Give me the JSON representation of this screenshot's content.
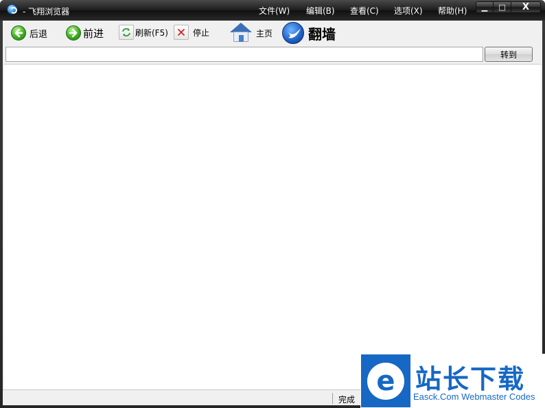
{
  "window": {
    "title": "- 飞翔浏览器",
    "controls": {
      "minimize": "▁",
      "maximize": "□",
      "close": "X"
    }
  },
  "menu": [
    {
      "label": "文件(W)"
    },
    {
      "label": "编辑(B)"
    },
    {
      "label": "查看(C)"
    },
    {
      "label": "选项(X)"
    },
    {
      "label": "帮助(H)"
    }
  ],
  "toolbar": {
    "back_label": "后退",
    "forward_label": "前进",
    "refresh_label": "刷新(F5)",
    "stop_label": "停止",
    "home_label": "主页",
    "fanqiang_label": "翻墙"
  },
  "address_bar": {
    "value": "",
    "go_label": "转到"
  },
  "status": {
    "text": "完成"
  },
  "watermark": {
    "title": "站长下载",
    "subtitle": "Easck.Com Webmaster Codes"
  },
  "colors": {
    "titlebar": "#1c1c1c",
    "accent_green": "#3fae1f",
    "watermark_blue": "#1668c4"
  }
}
